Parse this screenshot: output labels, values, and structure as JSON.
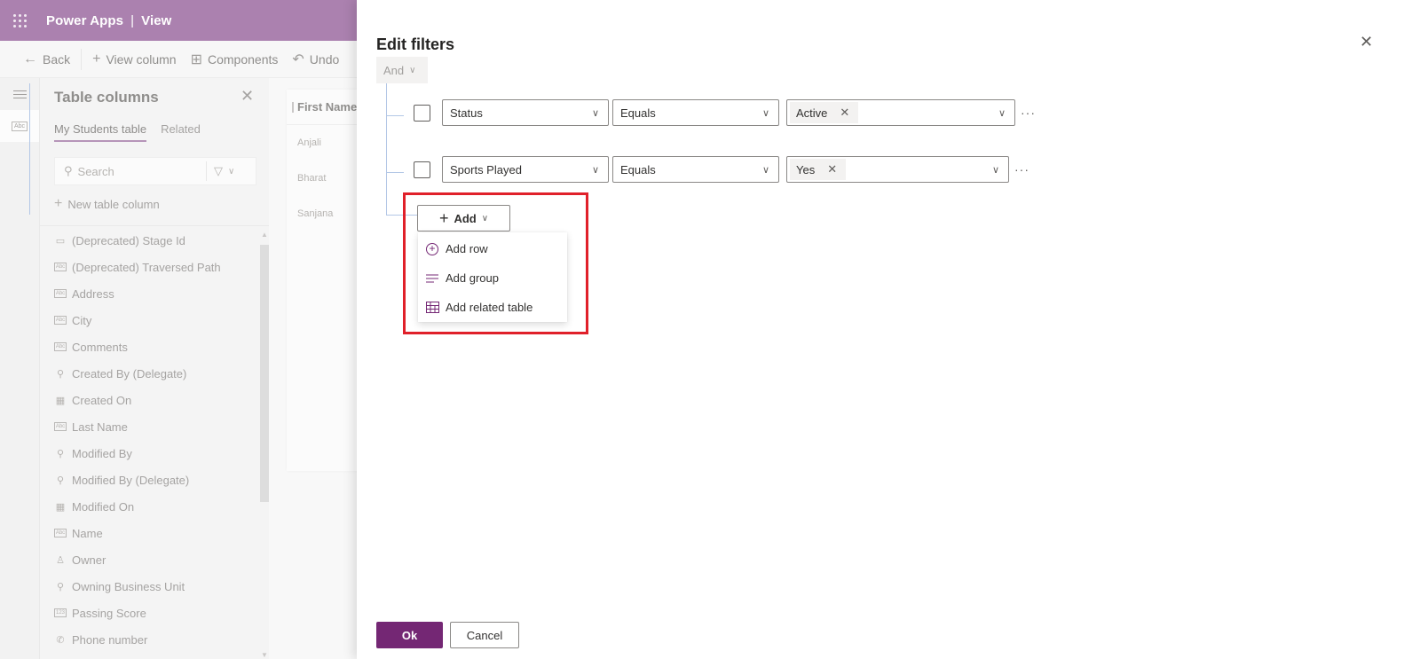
{
  "app": {
    "name": "Power Apps",
    "section": "View"
  },
  "commandbar": {
    "back": "Back",
    "view_column": "View column",
    "components": "Components",
    "undo": "Undo"
  },
  "leftrail": {
    "items": [
      {
        "icon": "hamburger-icon"
      },
      {
        "icon": "abc-text-icon",
        "label": "Abc"
      }
    ]
  },
  "table_columns": {
    "title": "Table columns",
    "tabs": [
      {
        "label": "My Students table",
        "active": true
      },
      {
        "label": "Related",
        "active": false
      }
    ],
    "search_placeholder": "Search",
    "new_column": "New table column",
    "columns": [
      {
        "label": "(Deprecated) Stage Id",
        "icon": "unique-id-icon",
        "glyph": "▭"
      },
      {
        "label": "(Deprecated) Traversed Path",
        "icon": "text-field-icon",
        "glyph": "Abc"
      },
      {
        "label": "Address",
        "icon": "text-field-icon",
        "glyph": "Abc"
      },
      {
        "label": "City",
        "icon": "text-field-icon",
        "glyph": "Abc"
      },
      {
        "label": "Comments",
        "icon": "text-field-icon",
        "glyph": "Abc"
      },
      {
        "label": "Created By (Delegate)",
        "icon": "lookup-icon",
        "glyph": "⚲"
      },
      {
        "label": "Created On",
        "icon": "date-time-icon",
        "glyph": "▦"
      },
      {
        "label": "Last Name",
        "icon": "text-field-icon",
        "glyph": "Abc"
      },
      {
        "label": "Modified By",
        "icon": "lookup-icon",
        "glyph": "⚲"
      },
      {
        "label": "Modified By (Delegate)",
        "icon": "lookup-icon",
        "glyph": "⚲"
      },
      {
        "label": "Modified On",
        "icon": "date-time-icon",
        "glyph": "▦"
      },
      {
        "label": "Name",
        "icon": "text-field-icon",
        "glyph": "Abc"
      },
      {
        "label": "Owner",
        "icon": "person-icon",
        "glyph": "♙"
      },
      {
        "label": "Owning Business Unit",
        "icon": "lookup-icon",
        "glyph": "⚲"
      },
      {
        "label": "Passing Score",
        "icon": "number-field-icon",
        "glyph": "123"
      },
      {
        "label": "Phone number",
        "icon": "phone-icon",
        "glyph": "✆"
      }
    ]
  },
  "grid": {
    "column_header": "First Name",
    "rows": [
      "Anjali",
      "Bharat",
      "Sanjana"
    ]
  },
  "edit_filters": {
    "title": "Edit filters",
    "group_operator": "And",
    "conditions": [
      {
        "field": "Status",
        "operator": "Equals",
        "values": [
          "Active"
        ]
      },
      {
        "field": "Sports Played",
        "operator": "Equals",
        "values": [
          "Yes"
        ]
      }
    ],
    "add_button": "Add",
    "add_menu": [
      {
        "label": "Add row",
        "icon": "add-circle-icon"
      },
      {
        "label": "Add group",
        "icon": "group-lines-icon"
      },
      {
        "label": "Add related table",
        "icon": "related-table-icon"
      }
    ],
    "ok": "Ok",
    "cancel": "Cancel"
  },
  "colors": {
    "brand_header": "#a77bab",
    "primary_button": "#742774",
    "highlight_box": "#e0202a",
    "tree_line": "#b3c7e6"
  }
}
